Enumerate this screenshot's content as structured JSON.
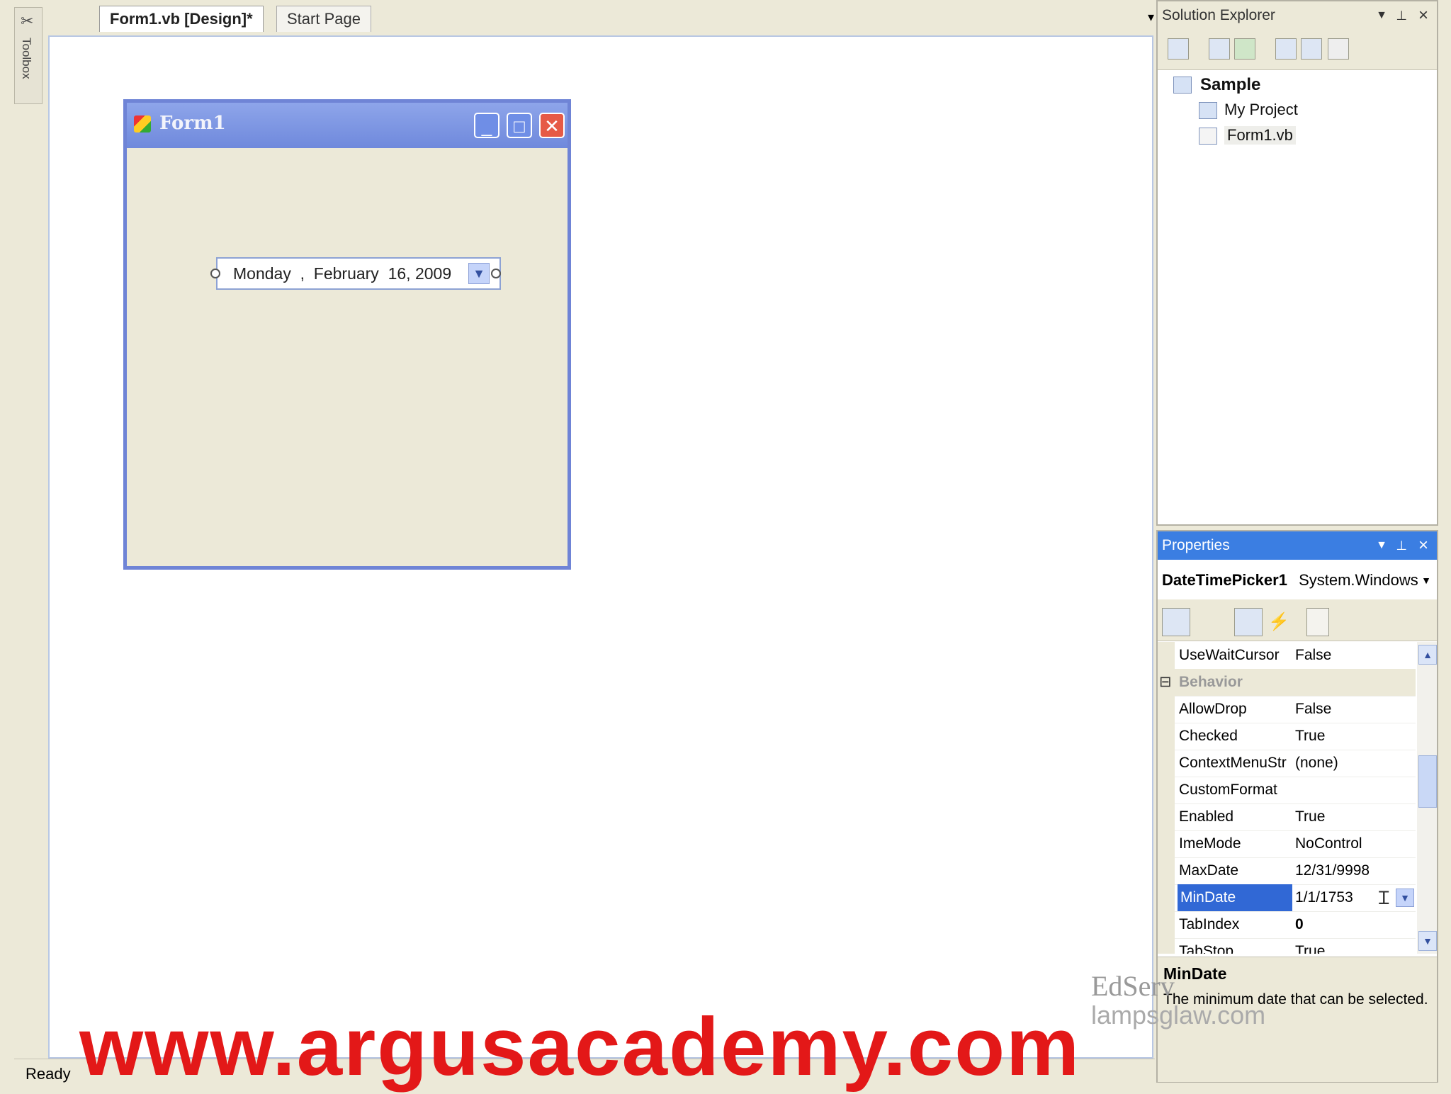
{
  "toolbox": {
    "label": "Toolbox"
  },
  "tabs": [
    {
      "label": "Form1.vb [Design]*"
    },
    {
      "label": "Start Page"
    }
  ],
  "tab_controls": {
    "menu": "▾",
    "close": "×"
  },
  "form": {
    "title": "Form1",
    "datepicker": {
      "value": "Monday  ,  February  16, 2009"
    }
  },
  "solution_explorer": {
    "title": "Solution Explorer",
    "tree": [
      {
        "label": "Sample"
      },
      {
        "label": "My Project"
      },
      {
        "label": "Form1.vb"
      }
    ]
  },
  "properties": {
    "title": "Properties",
    "object_name": "DateTimePicker1",
    "object_type": "System.Windows",
    "rows": [
      {
        "name": "UseWaitCursor",
        "value": "False"
      },
      {
        "name": "Behavior",
        "value": "",
        "category": true
      },
      {
        "name": "AllowDrop",
        "value": "False"
      },
      {
        "name": "Checked",
        "value": "True"
      },
      {
        "name": "ContextMenuStr",
        "value": "(none)"
      },
      {
        "name": "CustomFormat",
        "value": ""
      },
      {
        "name": "Enabled",
        "value": "True"
      },
      {
        "name": "ImeMode",
        "value": "NoControl"
      },
      {
        "name": "MaxDate",
        "value": "12/31/9998"
      },
      {
        "name": "MinDate",
        "value": "1/1/1753",
        "selected": true
      },
      {
        "name": "TabIndex",
        "value": "0"
      },
      {
        "name": "TabStop",
        "value": "True"
      }
    ],
    "description": {
      "title": "MinDate",
      "text": "The minimum date that can be selected."
    }
  },
  "status": {
    "text": "Ready"
  },
  "watermark": {
    "text": "www.argusacademy.com"
  },
  "logo": {
    "brand": "EdServ",
    "site": "lampsglaw.com"
  },
  "colors": {
    "accent": "#3b7ee2",
    "form_border": "#6f84d6",
    "watermark": "#e31818"
  }
}
